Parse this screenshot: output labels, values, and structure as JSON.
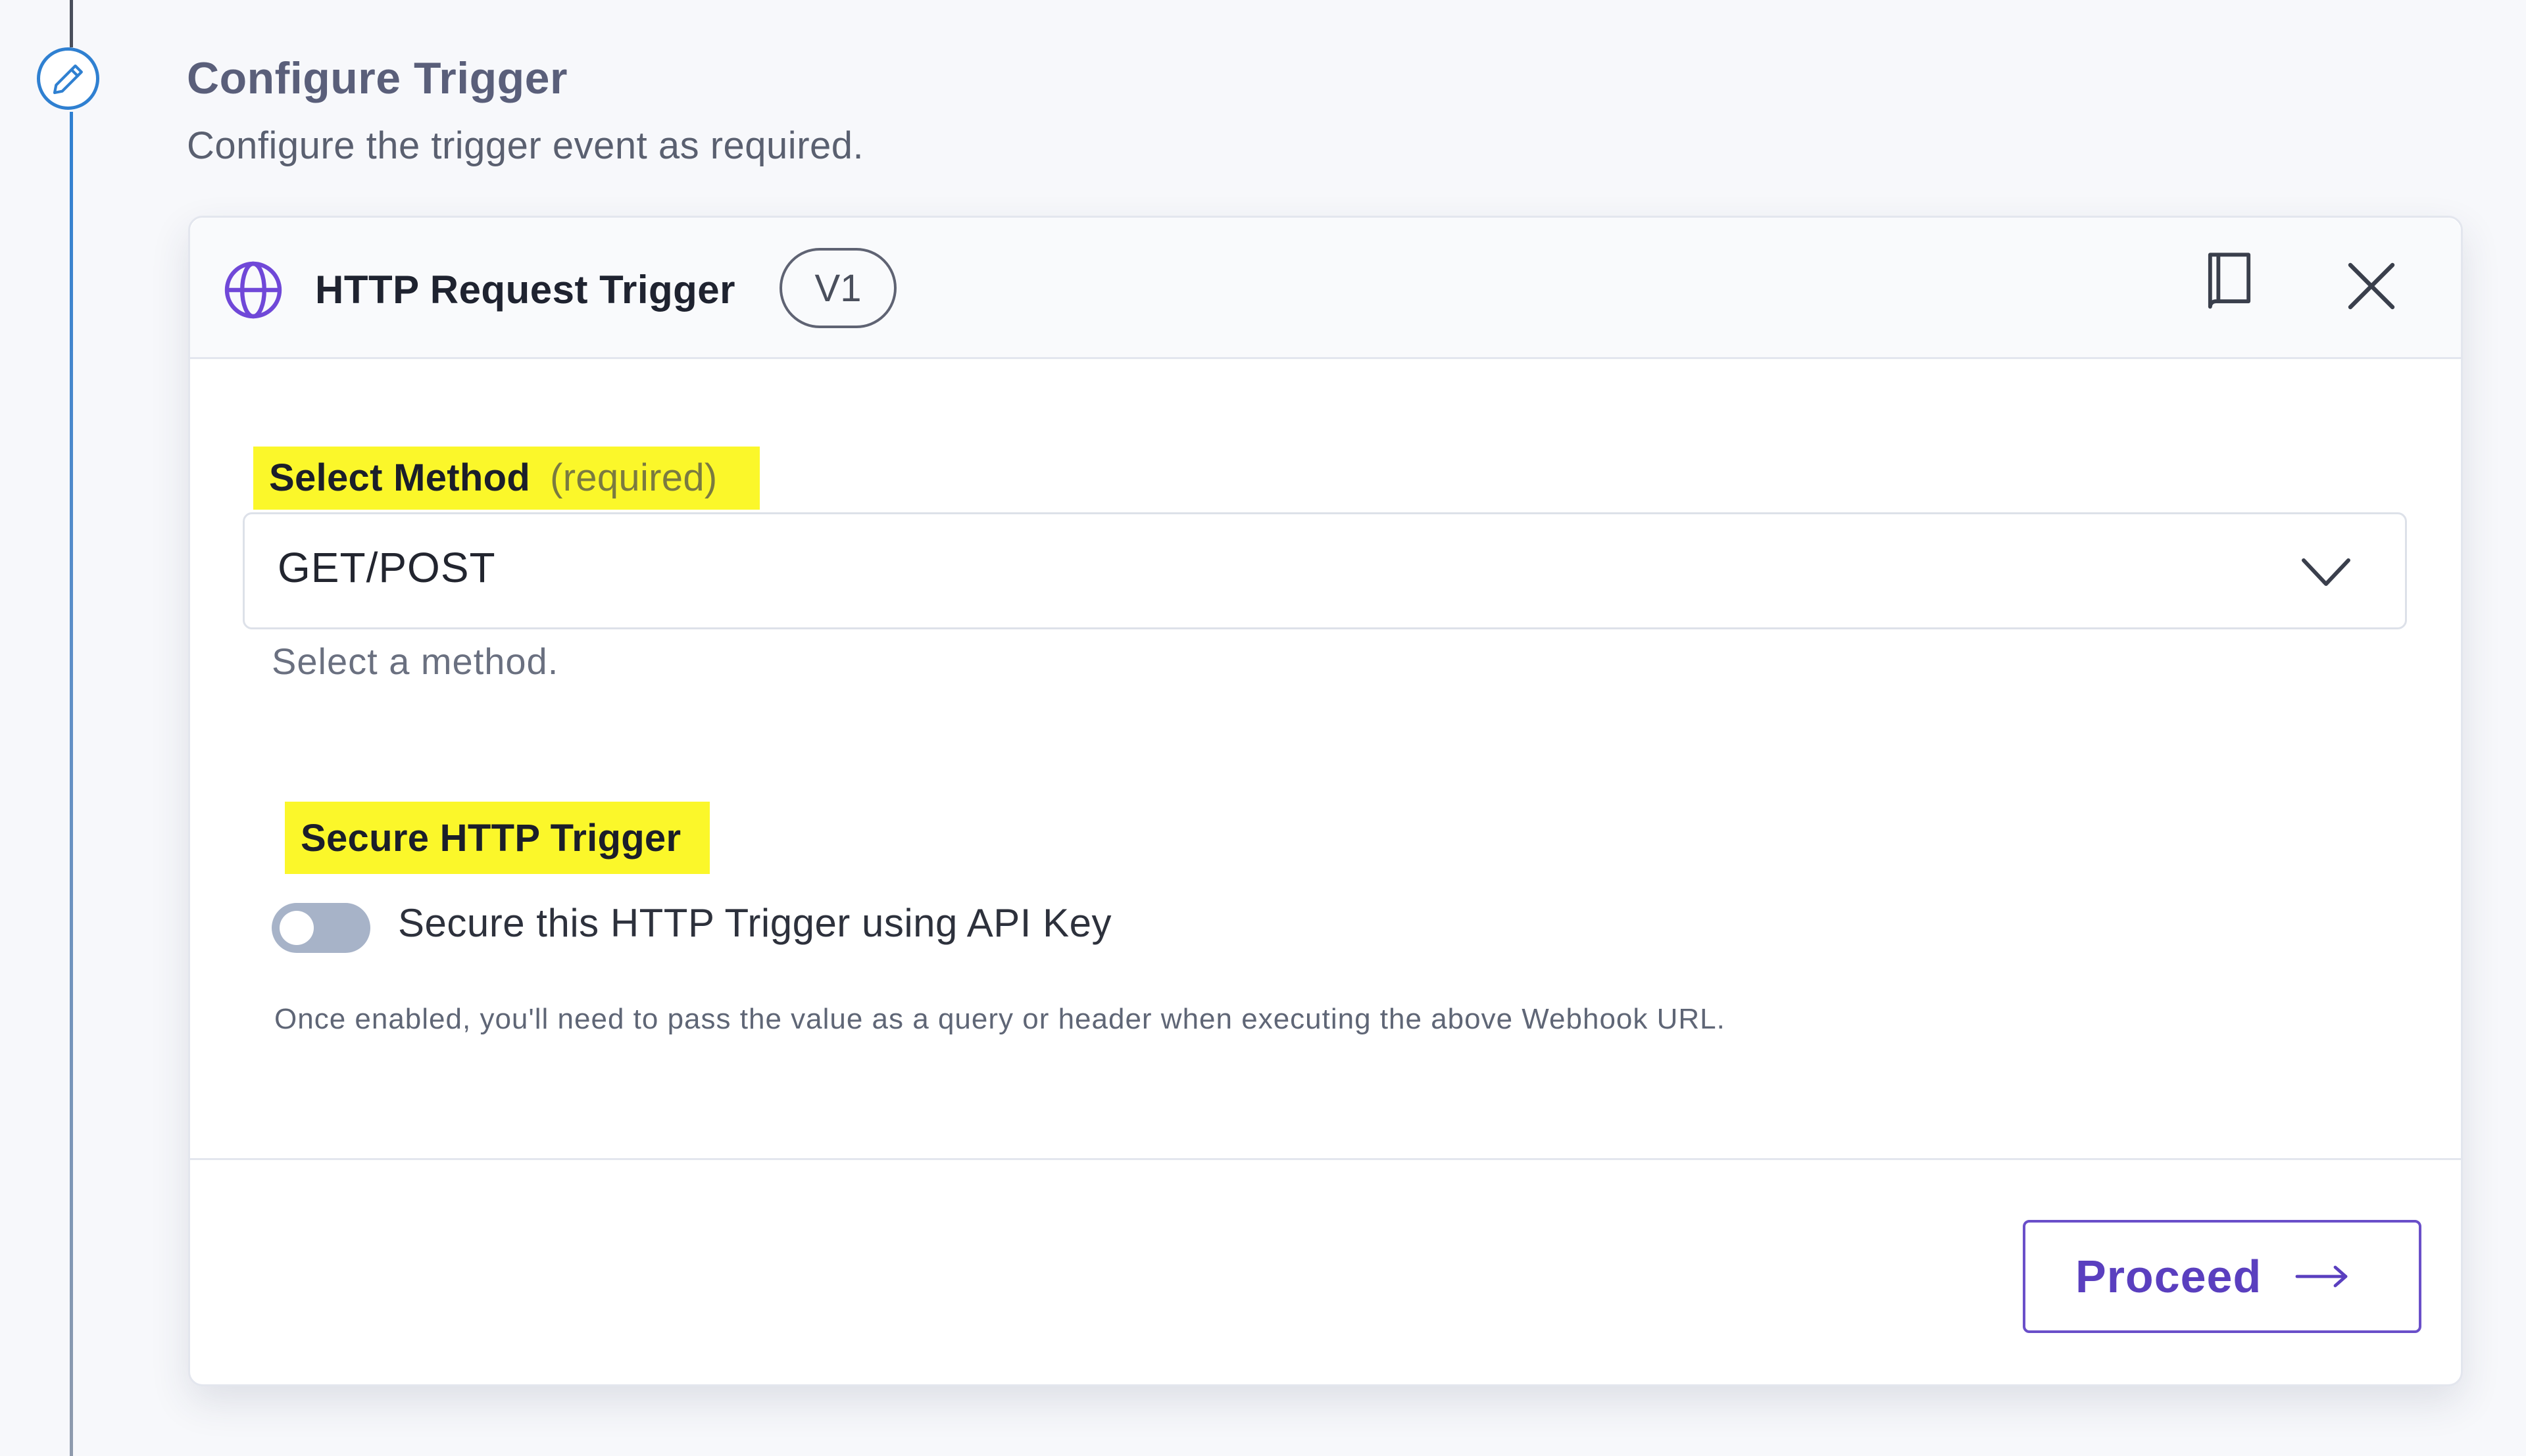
{
  "section": {
    "title": "Configure Trigger",
    "subtitle": "Configure the trigger event as required."
  },
  "card": {
    "title": "HTTP Request Trigger",
    "version": "V1",
    "icons": [
      "globe-icon",
      "book-icon",
      "close-icon",
      "pencil-icon"
    ]
  },
  "method": {
    "label": "Select Method",
    "required_text": "(required)",
    "value": "GET/POST",
    "helper": "Select a method."
  },
  "secure": {
    "label": "Secure HTTP Trigger",
    "toggle_label": "Secure this HTTP Trigger using API Key",
    "enabled": false,
    "note": "Once enabled, you'll need to pass the value as a query or header when executing the above Webhook URL."
  },
  "actions": {
    "proceed_label": "Proceed"
  },
  "colors": {
    "accent": "#2f80d1",
    "primary_button": "#5a3fbf",
    "highlight": "#fbf72a"
  }
}
